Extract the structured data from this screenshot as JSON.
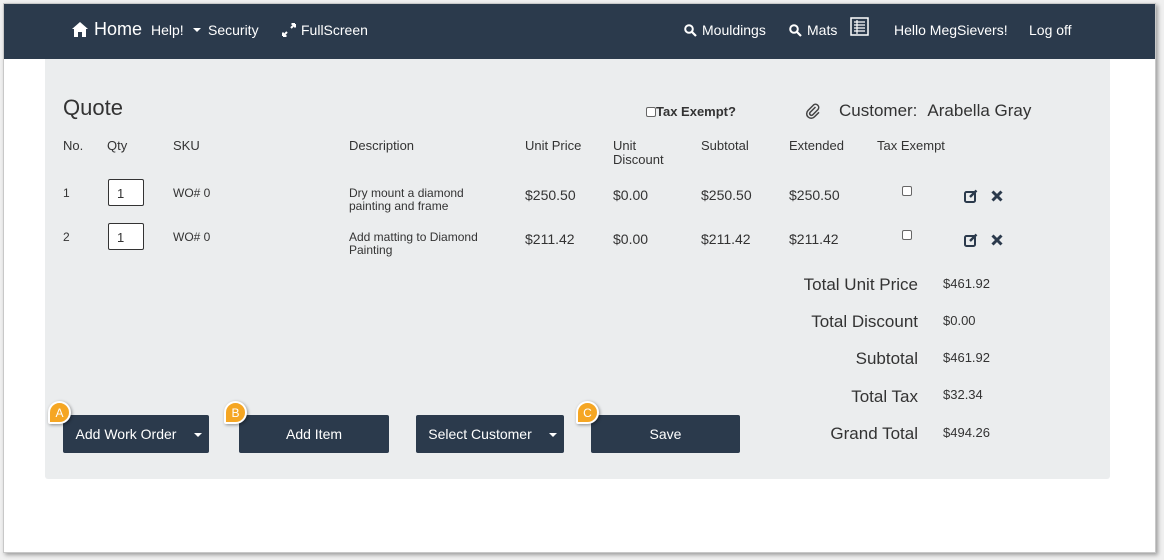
{
  "nav": {
    "home": "Home",
    "help": "Help!",
    "security": "Security",
    "fullscreen": "FullScreen",
    "mouldings": "Mouldings",
    "mats": "Mats",
    "greeting": "Hello MegSievers!",
    "logoff": "Log off"
  },
  "quote": {
    "title": "Quote",
    "tax_exempt_label": "Tax Exempt?",
    "customer_label": "Customer:",
    "customer_name": "Arabella Gray"
  },
  "table": {
    "headers": {
      "no": "No.",
      "qty": "Qty",
      "sku": "SKU",
      "description": "Description",
      "unit_price": "Unit Price",
      "unit_discount_1": "Unit",
      "unit_discount_2": "Discount",
      "subtotal": "Subtotal",
      "extended": "Extended",
      "tax_exempt": "Tax Exempt"
    },
    "rows": [
      {
        "no": "1",
        "qty": "1",
        "sku": "WO# 0",
        "desc_1": "Dry mount a diamond",
        "desc_2": "painting and frame",
        "unit_price": "$250.50",
        "unit_discount": "$0.00",
        "subtotal": "$250.50",
        "extended": "$250.50"
      },
      {
        "no": "2",
        "qty": "1",
        "sku": "WO# 0",
        "desc_1": "Add matting to Diamond",
        "desc_2": "Painting",
        "unit_price": "$211.42",
        "unit_discount": "$0.00",
        "subtotal": "$211.42",
        "extended": "$211.42"
      }
    ]
  },
  "totals": {
    "unit_price_label": "Total Unit Price",
    "unit_price": "$461.92",
    "discount_label": "Total Discount",
    "discount": "$0.00",
    "subtotal_label": "Subtotal",
    "subtotal": "$461.92",
    "tax_label": "Total Tax",
    "tax": "$32.34",
    "grand_label": "Grand Total",
    "grand": "$494.26"
  },
  "buttons": {
    "add_work_order": "Add Work Order",
    "add_item": "Add Item",
    "select_customer": "Select Customer",
    "save": "Save"
  },
  "callouts": {
    "a": "A",
    "b": "B",
    "c": "C"
  },
  "colors": {
    "navbar": "#2b3a4c",
    "panel": "#ebedee",
    "callout": "#f5a623"
  }
}
